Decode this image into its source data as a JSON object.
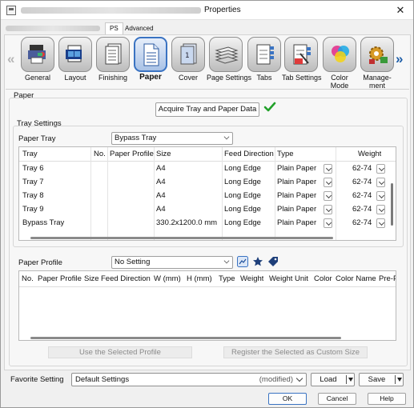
{
  "window": {
    "title": "Properties"
  },
  "top_tabs": [
    {
      "label": "PS"
    },
    {
      "label": "Advanced"
    }
  ],
  "categories": [
    {
      "label": "General",
      "icon": "general-icon"
    },
    {
      "label": "Layout",
      "icon": "layout-icon"
    },
    {
      "label": "Finishing",
      "icon": "finishing-icon"
    },
    {
      "label": "Paper",
      "icon": "paper-icon",
      "active": true
    },
    {
      "label": "Cover",
      "icon": "cover-icon"
    },
    {
      "label": "Page Settings",
      "icon": "page-settings-icon"
    },
    {
      "label": "Tabs",
      "icon": "tabs-icon"
    },
    {
      "label": "Tab Settings",
      "icon": "tab-settings-icon"
    },
    {
      "label": "Color Mode",
      "label_line1": "Color",
      "label_line2": "Mode",
      "icon": "color-mode-icon"
    },
    {
      "label": "Management",
      "label_line1": "Manage-",
      "label_line2": "ment",
      "icon": "management-icon"
    }
  ],
  "paper_section": {
    "title": "Paper",
    "acquire_button": "Acquire Tray and Paper Data"
  },
  "tray_settings": {
    "title": "Tray Settings",
    "paper_tray_label": "Paper Tray",
    "paper_tray_value": "Bypass Tray",
    "columns": [
      "Tray",
      "No.",
      "Paper Profile",
      "Size",
      "Feed Direction",
      "Type",
      "Weight"
    ],
    "rows": [
      {
        "tray": "Tray 6",
        "no": "",
        "profile": "",
        "size": "A4",
        "feed": "Long Edge",
        "type": "Plain Paper",
        "weight": "62-74"
      },
      {
        "tray": "Tray 7",
        "no": "",
        "profile": "",
        "size": "A4",
        "feed": "Long Edge",
        "type": "Plain Paper",
        "weight": "62-74"
      },
      {
        "tray": "Tray 8",
        "no": "",
        "profile": "",
        "size": "A4",
        "feed": "Long Edge",
        "type": "Plain Paper",
        "weight": "62-74"
      },
      {
        "tray": "Tray 9",
        "no": "",
        "profile": "",
        "size": "A4",
        "feed": "Long Edge",
        "type": "Plain Paper",
        "weight": "62-74"
      },
      {
        "tray": "Bypass Tray",
        "no": "",
        "profile": "",
        "size": "330.2x1200.0 mm",
        "feed": "Long Edge",
        "type": "Plain Paper",
        "weight": "62-74"
      }
    ]
  },
  "paper_profile": {
    "label": "Paper Profile",
    "value": "No Setting",
    "columns": [
      "No.",
      "Paper Profile",
      "Size",
      "Feed Direction",
      "W (mm)",
      "H (mm)",
      "Type",
      "Weight",
      "Weight Unit",
      "Color",
      "Color Name",
      "Pre-P"
    ],
    "use_selected_button": "Use the Selected Profile",
    "register_button": "Register the Selected as Custom Size"
  },
  "favorite": {
    "label": "Favorite Setting",
    "value": "Default Settings",
    "modified": "(modified)",
    "load_button": "Load",
    "save_button": "Save"
  },
  "buttons": {
    "ok": "OK",
    "cancel": "Cancel",
    "help": "Help"
  }
}
